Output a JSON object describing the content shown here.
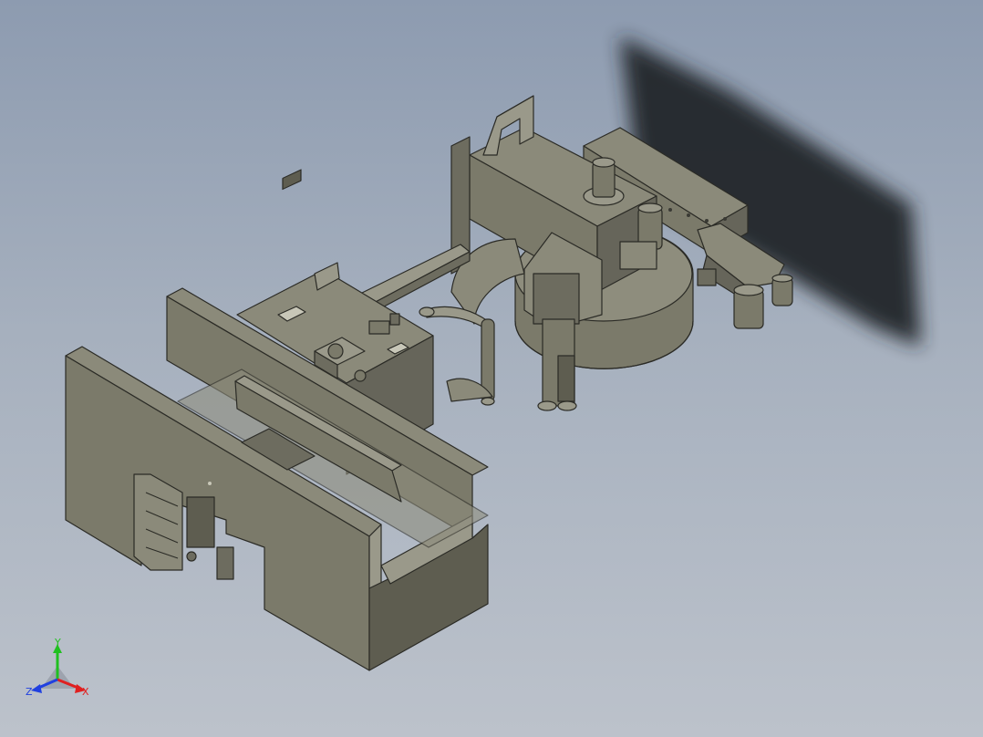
{
  "viewport": {
    "background_top": "#8d9bb0",
    "background_bottom": "#bcc2cb",
    "model_face_color": "#7b7a6a",
    "model_top_color": "#8b8a7a",
    "model_dark_color": "#5e5d50",
    "shadow_color": "#23262c"
  },
  "triad": {
    "x_label": "X",
    "y_label": "Y",
    "z_label": "Z",
    "x_color": "#e02020",
    "y_color": "#20c020",
    "z_color": "#2040e0"
  },
  "icons": [
    "coordinate-triad-icon"
  ]
}
